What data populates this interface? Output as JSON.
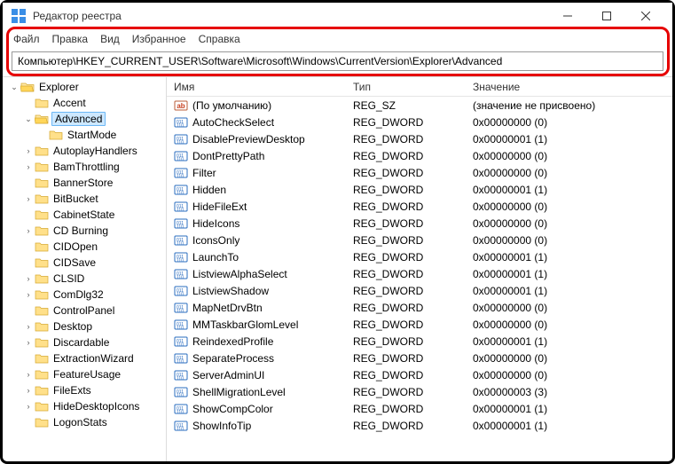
{
  "window": {
    "title": "Редактор реестра"
  },
  "menu": {
    "items": [
      "Файл",
      "Правка",
      "Вид",
      "Избранное",
      "Справка"
    ]
  },
  "address": {
    "value": "Компьютер\\HKEY_CURRENT_USER\\Software\\Microsoft\\Windows\\CurrentVersion\\Explorer\\Advanced"
  },
  "tree": [
    {
      "label": "Explorer",
      "indent": 0,
      "expandable": true,
      "expanded": true,
      "open": true
    },
    {
      "label": "Accent",
      "indent": 1,
      "expandable": false
    },
    {
      "label": "Advanced",
      "indent": 1,
      "expandable": true,
      "expanded": true,
      "open": true,
      "selected": true
    },
    {
      "label": "StartMode",
      "indent": 2,
      "expandable": false
    },
    {
      "label": "AutoplayHandlers",
      "indent": 1,
      "expandable": true
    },
    {
      "label": "BamThrottling",
      "indent": 1,
      "expandable": true
    },
    {
      "label": "BannerStore",
      "indent": 1,
      "expandable": false
    },
    {
      "label": "BitBucket",
      "indent": 1,
      "expandable": true
    },
    {
      "label": "CabinetState",
      "indent": 1,
      "expandable": false
    },
    {
      "label": "CD Burning",
      "indent": 1,
      "expandable": true
    },
    {
      "label": "CIDOpen",
      "indent": 1,
      "expandable": false
    },
    {
      "label": "CIDSave",
      "indent": 1,
      "expandable": false
    },
    {
      "label": "CLSID",
      "indent": 1,
      "expandable": true
    },
    {
      "label": "ComDlg32",
      "indent": 1,
      "expandable": true
    },
    {
      "label": "ControlPanel",
      "indent": 1,
      "expandable": false
    },
    {
      "label": "Desktop",
      "indent": 1,
      "expandable": true
    },
    {
      "label": "Discardable",
      "indent": 1,
      "expandable": true
    },
    {
      "label": "ExtractionWizard",
      "indent": 1,
      "expandable": false
    },
    {
      "label": "FeatureUsage",
      "indent": 1,
      "expandable": true
    },
    {
      "label": "FileExts",
      "indent": 1,
      "expandable": true
    },
    {
      "label": "HideDesktopIcons",
      "indent": 1,
      "expandable": true
    },
    {
      "label": "LogonStats",
      "indent": 1,
      "expandable": false
    }
  ],
  "list": {
    "headers": {
      "name": "Имя",
      "type": "Тип",
      "value": "Значение"
    },
    "rows": [
      {
        "icon": "string",
        "name": "(По умолчанию)",
        "type": "REG_SZ",
        "value": "(значение не присвоено)"
      },
      {
        "icon": "dword",
        "name": "AutoCheckSelect",
        "type": "REG_DWORD",
        "value": "0x00000000 (0)"
      },
      {
        "icon": "dword",
        "name": "DisablePreviewDesktop",
        "type": "REG_DWORD",
        "value": "0x00000001 (1)"
      },
      {
        "icon": "dword",
        "name": "DontPrettyPath",
        "type": "REG_DWORD",
        "value": "0x00000000 (0)"
      },
      {
        "icon": "dword",
        "name": "Filter",
        "type": "REG_DWORD",
        "value": "0x00000000 (0)"
      },
      {
        "icon": "dword",
        "name": "Hidden",
        "type": "REG_DWORD",
        "value": "0x00000001 (1)"
      },
      {
        "icon": "dword",
        "name": "HideFileExt",
        "type": "REG_DWORD",
        "value": "0x00000000 (0)"
      },
      {
        "icon": "dword",
        "name": "HideIcons",
        "type": "REG_DWORD",
        "value": "0x00000000 (0)"
      },
      {
        "icon": "dword",
        "name": "IconsOnly",
        "type": "REG_DWORD",
        "value": "0x00000000 (0)"
      },
      {
        "icon": "dword",
        "name": "LaunchTo",
        "type": "REG_DWORD",
        "value": "0x00000001 (1)"
      },
      {
        "icon": "dword",
        "name": "ListviewAlphaSelect",
        "type": "REG_DWORD",
        "value": "0x00000001 (1)"
      },
      {
        "icon": "dword",
        "name": "ListviewShadow",
        "type": "REG_DWORD",
        "value": "0x00000001 (1)"
      },
      {
        "icon": "dword",
        "name": "MapNetDrvBtn",
        "type": "REG_DWORD",
        "value": "0x00000000 (0)"
      },
      {
        "icon": "dword",
        "name": "MMTaskbarGlomLevel",
        "type": "REG_DWORD",
        "value": "0x00000000 (0)"
      },
      {
        "icon": "dword",
        "name": "ReindexedProfile",
        "type": "REG_DWORD",
        "value": "0x00000001 (1)"
      },
      {
        "icon": "dword",
        "name": "SeparateProcess",
        "type": "REG_DWORD",
        "value": "0x00000000 (0)"
      },
      {
        "icon": "dword",
        "name": "ServerAdminUI",
        "type": "REG_DWORD",
        "value": "0x00000000 (0)"
      },
      {
        "icon": "dword",
        "name": "ShellMigrationLevel",
        "type": "REG_DWORD",
        "value": "0x00000003 (3)"
      },
      {
        "icon": "dword",
        "name": "ShowCompColor",
        "type": "REG_DWORD",
        "value": "0x00000001 (1)"
      },
      {
        "icon": "dword",
        "name": "ShowInfoTip",
        "type": "REG_DWORD",
        "value": "0x00000001 (1)"
      }
    ]
  }
}
